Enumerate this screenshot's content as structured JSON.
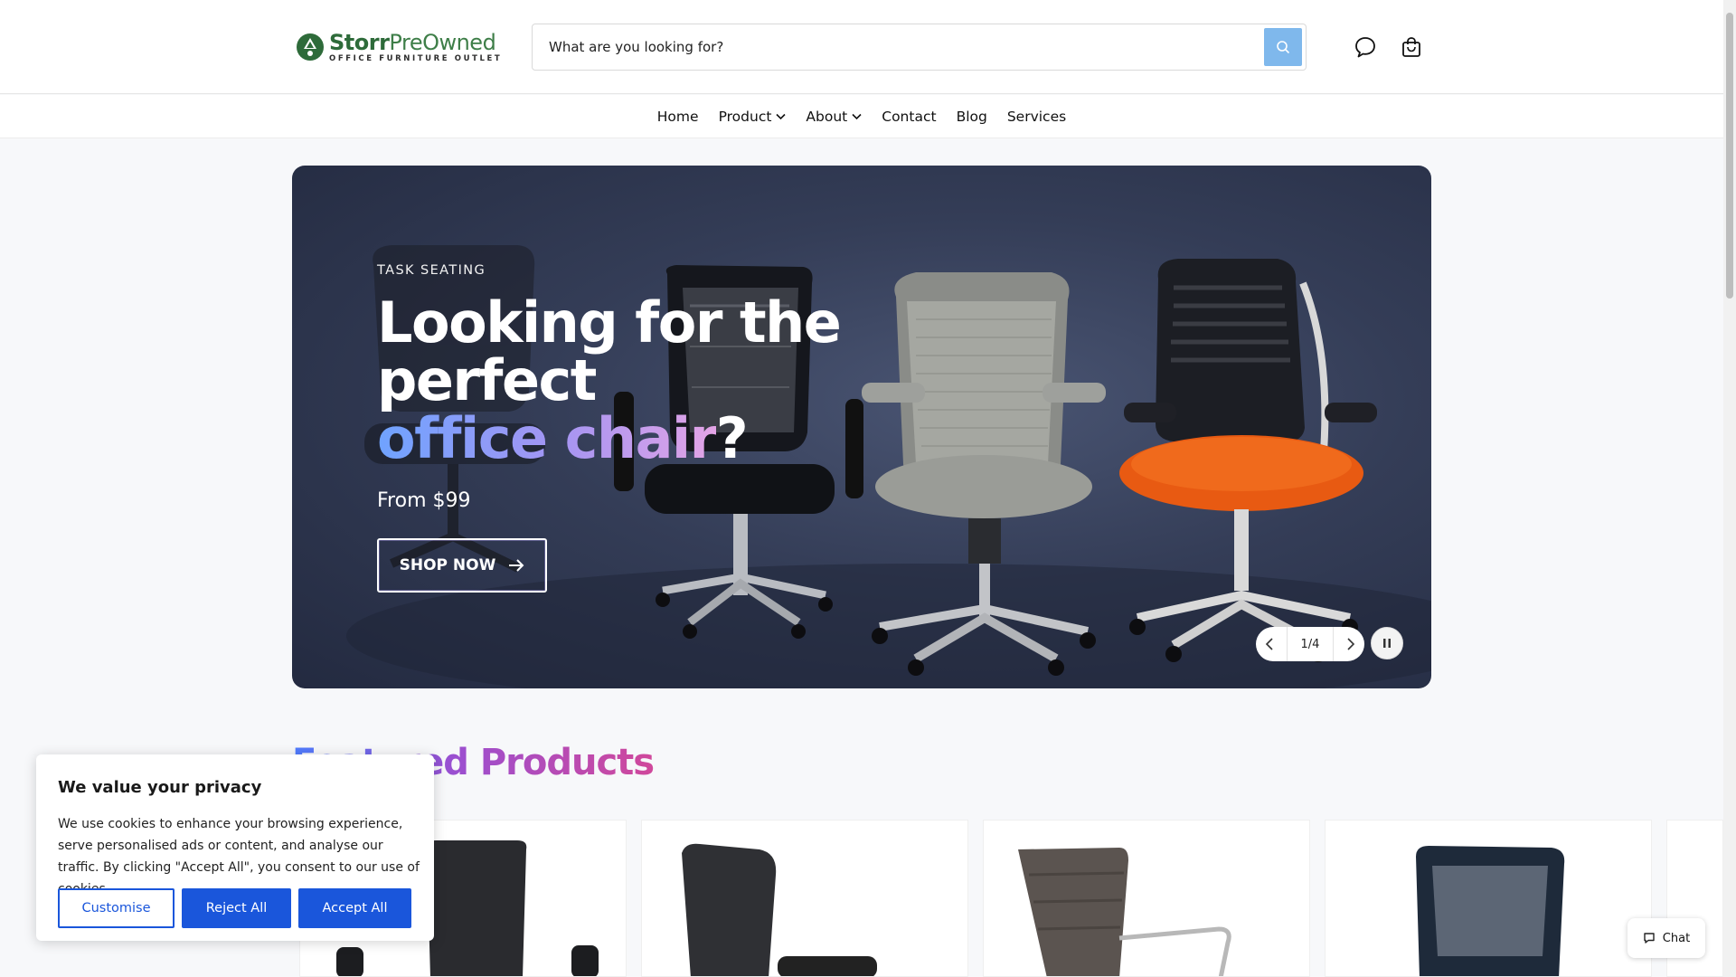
{
  "brand": {
    "name_bold": "Storr",
    "name_light": "PreOwned",
    "tagline": "OFFICE FURNITURE OUTLET"
  },
  "search": {
    "placeholder": "What are you looking for?"
  },
  "header_icons": [
    "chat-bubble-icon",
    "shopping-bag-icon"
  ],
  "nav": {
    "items": [
      {
        "label": "Home",
        "dropdown": false
      },
      {
        "label": "Product",
        "dropdown": true
      },
      {
        "label": "About",
        "dropdown": true
      },
      {
        "label": "Contact",
        "dropdown": false
      },
      {
        "label": "Blog",
        "dropdown": false
      },
      {
        "label": "Services",
        "dropdown": false
      }
    ]
  },
  "hero": {
    "eyebrow": "TASK SEATING",
    "title_line1": "Looking for the",
    "title_line2": "perfect",
    "title_highlight": "office chair",
    "title_end": "?",
    "price": "From $99",
    "cta": "SHOP NOW",
    "slide_counter": "1/4"
  },
  "featured": {
    "title": "Featured Products"
  },
  "cookie": {
    "title": "We value your privacy",
    "text": "We use cookies to enhance your browsing experience, serve personalised ads or content, and analyse our traffic. By clicking \"Accept All\", you consent to our use of cookies.",
    "customise": "Customise",
    "reject": "Reject All",
    "accept": "Accept All"
  },
  "chat": {
    "label": "Chat"
  },
  "colors": {
    "accent": "#1a56db",
    "search_button": "#7fb8ec",
    "brand_green": "#2e6b3a",
    "hero_bg": "#343d57"
  }
}
